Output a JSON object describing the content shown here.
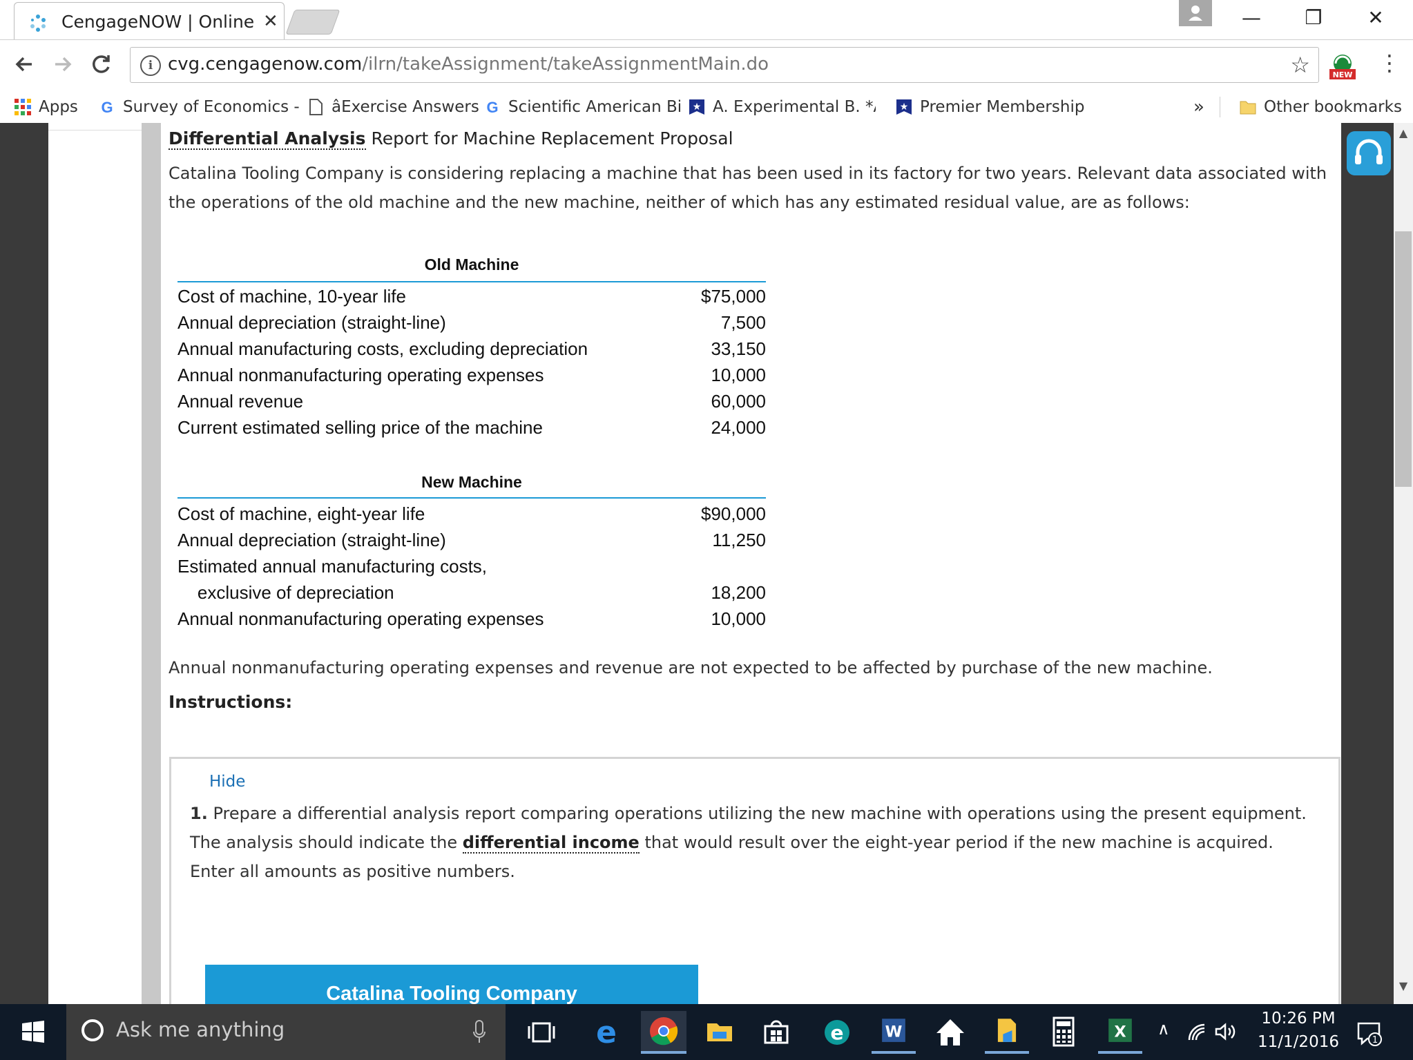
{
  "browser": {
    "tab_title": "CengageNOW | Online te",
    "tab_close": "✕",
    "url_host": "cvg.cengagenow.com",
    "url_path": "/ilrn/takeAssignment/takeAssignmentMain.do",
    "ext_badge": "NEW",
    "window_controls": {
      "minimize": "—",
      "restore": "❐",
      "close": "✕"
    }
  },
  "bookmarks": [
    {
      "label": "Apps",
      "icon": "apps-grid-icon"
    },
    {
      "label": "Survey of Economics -",
      "icon": "google-g-icon"
    },
    {
      "label": "âExercise Answers",
      "icon": "page-icon"
    },
    {
      "label": "Scientific American Bi",
      "icon": "google-g-icon"
    },
    {
      "label": "A. Experimental B. *Ar",
      "icon": "star-badge-icon"
    },
    {
      "label": "Premier Membership",
      "icon": "star-badge-icon"
    }
  ],
  "bookmarks_overflow": "»",
  "other_bookmarks": "Other bookmarks",
  "content": {
    "heading_term": "Differential Analysis",
    "heading_rest": " Report for Machine Replacement Proposal",
    "intro": "Catalina Tooling Company is considering replacing a machine that has been used in its factory for two years. Relevant data associated with the operations of the old machine and the new machine, neither of which has any estimated residual value, are as follows:",
    "old_machine": {
      "caption": "Old Machine",
      "rows": [
        {
          "label": "Cost of machine, 10-year life",
          "value": "$75,000"
        },
        {
          "label": "Annual depreciation (straight-line)",
          "value": "7,500"
        },
        {
          "label": "Annual manufacturing costs, excluding depreciation",
          "value": "33,150"
        },
        {
          "label": "Annual nonmanufacturing operating expenses",
          "value": "10,000"
        },
        {
          "label": "Annual revenue",
          "value": "60,000"
        },
        {
          "label": "Current estimated selling price of the machine",
          "value": "24,000"
        }
      ]
    },
    "new_machine": {
      "caption": "New Machine",
      "rows": [
        {
          "label": "Cost of machine, eight-year life",
          "value": "$90,000"
        },
        {
          "label": "Annual depreciation (straight-line)",
          "value": "11,250"
        },
        {
          "label": "Estimated annual manufacturing costs,",
          "value": ""
        },
        {
          "label": "    exclusive of depreciation",
          "value": "18,200"
        },
        {
          "label": "Annual nonmanufacturing operating expenses",
          "value": "10,000"
        }
      ]
    },
    "note": "Annual nonmanufacturing operating expenses and revenue are not expected to be affected by purchase of the new machine.",
    "instructions_label": "Instructions:",
    "hide_link": "Hide",
    "instruction_number": "1.",
    "instruction_part1": " Prepare a differential analysis report comparing operations utilizing the new machine with operations using the present equipment. The analysis should indicate the ",
    "instruction_term": "differential income",
    "instruction_part2": " that would result over the eight-year period if the new machine is acquired. Enter all amounts as positive numbers.",
    "company_header": "Catalina Tooling Company"
  },
  "taskbar": {
    "search_placeholder": "Ask me anything",
    "time": "10:26 PM",
    "date": "11/1/2016",
    "notification_count": "1"
  },
  "colors": {
    "accent_blue": "#1b9ad6",
    "link_blue": "#1a6fb4",
    "taskbar_bg": "#0f1a28"
  }
}
